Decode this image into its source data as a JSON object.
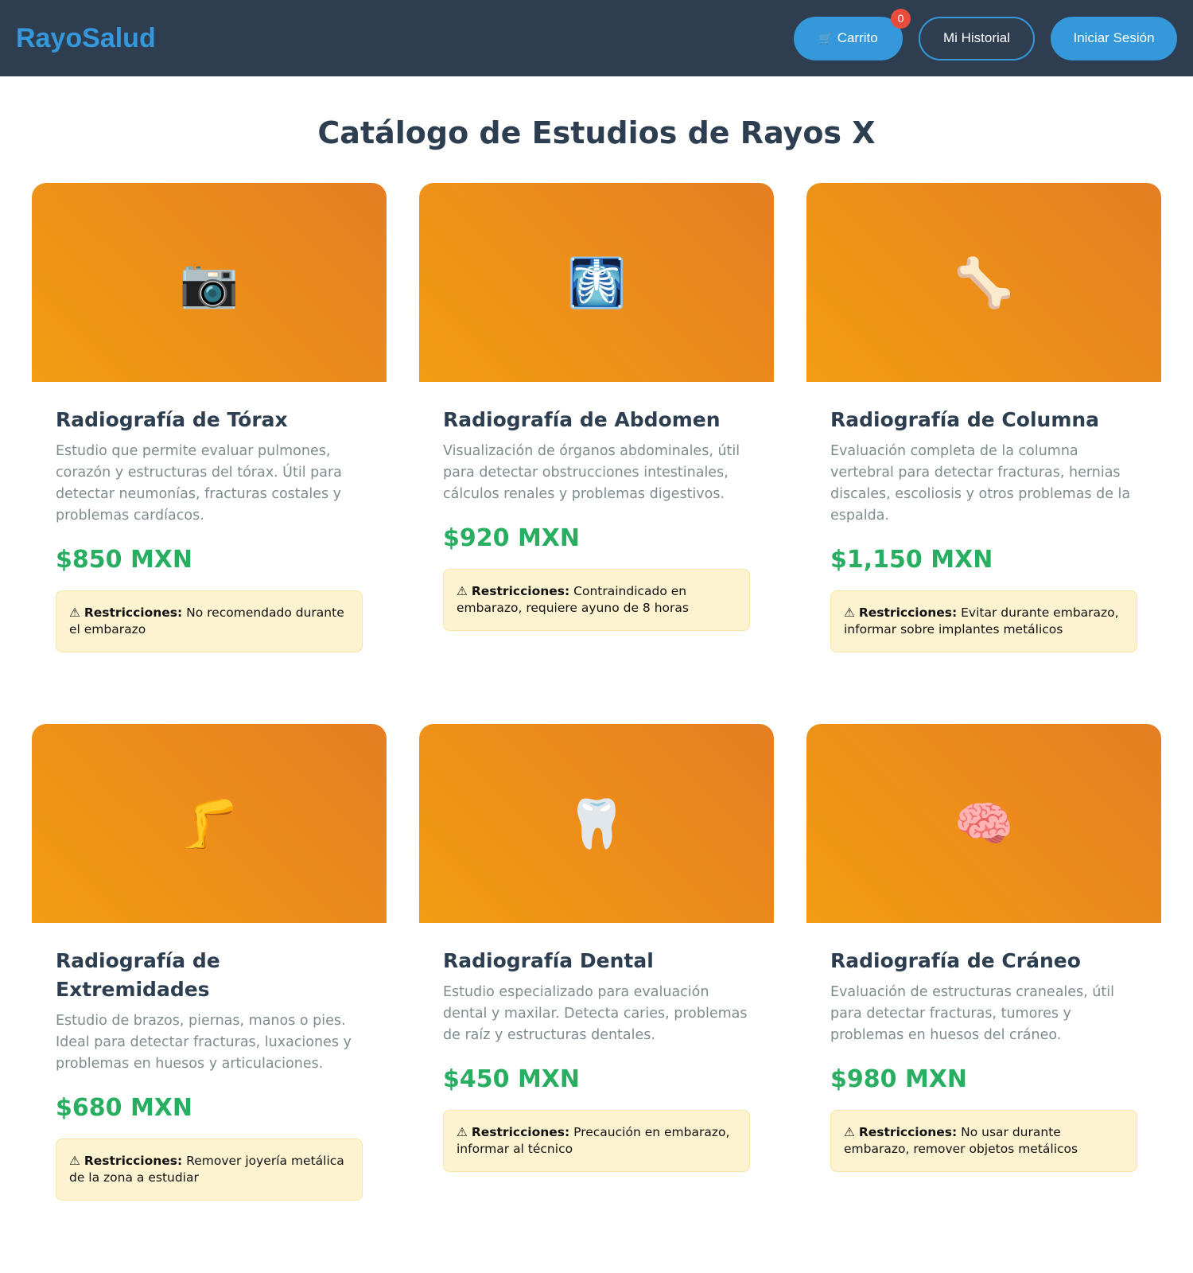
{
  "header": {
    "logo": "RayoSalud",
    "cart": {
      "icon": "cart-icon",
      "label": "Carrito",
      "count": "0"
    },
    "history_label": "Mi Historial",
    "login_label": "Iniciar Sesión"
  },
  "page_title": "Catálogo de Estudios de Rayos X",
  "restriction_prefix": "Restricciones:",
  "warning_symbol": "⚠",
  "colors": {
    "header_bg": "#2e3e50",
    "accent": "#3498db",
    "price": "#27ae60",
    "card_gradient_start": "#f39c12",
    "card_gradient_end": "#e67e22",
    "badge": "#e74c3c"
  },
  "studies": [
    {
      "icon": "camera-icon",
      "emoji": "📷",
      "title": "Radiografía de Tórax",
      "description": "Estudio que permite evaluar pulmones, corazón y estructuras del tórax. Útil para detectar neumonías, fracturas costales y problemas cardíacos.",
      "price": "$850 MXN",
      "restriction": "No recomendado durante el embarazo"
    },
    {
      "icon": "xray-skeleton-icon",
      "emoji": "🩻",
      "title": "Radiografía de Abdomen",
      "description": "Visualización de órganos abdominales, útil para detectar obstrucciones intestinales, cálculos renales y problemas digestivos.",
      "price": "$920 MXN",
      "restriction": "Contraindicado en embarazo, requiere ayuno de 8 horas"
    },
    {
      "icon": "bone-icon",
      "emoji": "🦴",
      "title": "Radiografía de Columna",
      "description": "Evaluación completa de la columna vertebral para detectar fracturas, hernias discales, escoliosis y otros problemas de la espalda.",
      "price": "$1,150 MXN",
      "restriction": "Evitar durante embarazo, informar sobre implantes metálicos"
    },
    {
      "icon": "leg-icon",
      "emoji": "🦵",
      "title": "Radiografía de Extremidades",
      "description": "Estudio de brazos, piernas, manos o pies. Ideal para detectar fracturas, luxaciones y problemas en huesos y articulaciones.",
      "price": "$680 MXN",
      "restriction": "Remover joyería metálica de la zona a estudiar"
    },
    {
      "icon": "tooth-icon",
      "emoji": "🦷",
      "title": "Radiografía Dental",
      "description": "Estudio especializado para evaluación dental y maxilar. Detecta caries, problemas de raíz y estructuras dentales.",
      "price": "$450 MXN",
      "restriction": "Precaución en embarazo, informar al técnico"
    },
    {
      "icon": "brain-icon",
      "emoji": "🧠",
      "title": "Radiografía de Cráneo",
      "description": "Evaluación de estructuras craneales, útil para detectar fracturas, tumores y problemas en huesos del cráneo.",
      "price": "$980 MXN",
      "restriction": "No usar durante embarazo, remover objetos metálicos"
    }
  ]
}
